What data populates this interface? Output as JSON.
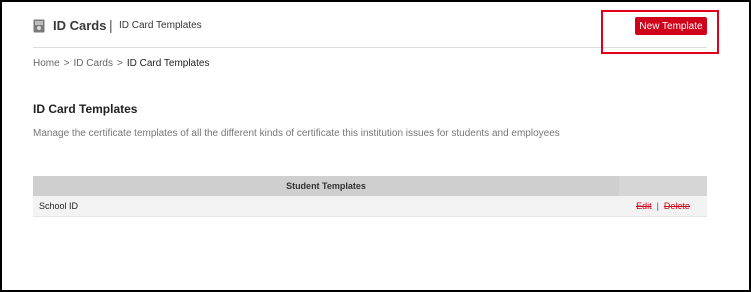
{
  "header": {
    "app_title": "ID Cards",
    "divider": "|",
    "page_subtitle": "ID Card Templates",
    "new_template_label": "New Template",
    "icon": "id-card-icon"
  },
  "breadcrumb": {
    "items": [
      "Home",
      "ID Cards",
      "ID Card Templates"
    ],
    "separator": ">"
  },
  "main": {
    "title": "ID Card Templates",
    "description": "Manage the certificate templates of all the different kinds of certificate this institution issues for students and employees"
  },
  "table": {
    "header": "Student Templates",
    "rows": [
      {
        "name": "School ID",
        "edit_label": "Edit",
        "delete_label": "Delete",
        "sep": "|"
      }
    ]
  },
  "colors": {
    "accent": "#d0021b",
    "highlight_border": "#e0001b",
    "table_header_bg": "#cfcfcf",
    "row_bg": "#f3f3f3"
  }
}
